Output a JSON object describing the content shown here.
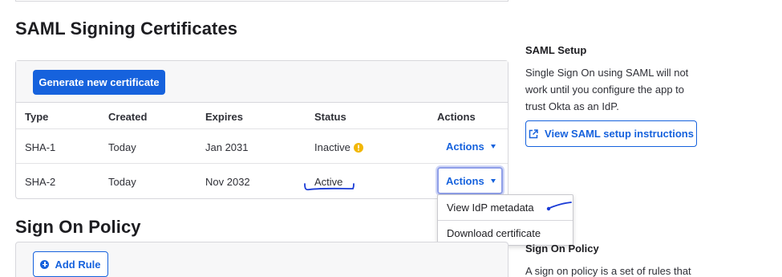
{
  "cert_section": {
    "title": "SAML Signing Certificates",
    "generate_button": "Generate new certificate",
    "columns": [
      "Type",
      "Created",
      "Expires",
      "Status",
      "Actions"
    ],
    "rows": [
      {
        "type": "SHA-1",
        "created": "Today",
        "expires": "Jan 2031",
        "status": "Inactive",
        "status_icon": "warning-icon",
        "actions": "Actions"
      },
      {
        "type": "SHA-2",
        "created": "Today",
        "expires": "Nov 2032",
        "status": "Active",
        "actions": "Actions"
      }
    ]
  },
  "actions_menu": {
    "items": [
      "View IdP metadata",
      "Download certificate"
    ]
  },
  "signon_section": {
    "title": "Sign On Policy",
    "add_rule_button": "Add Rule"
  },
  "sidebar": {
    "saml_setup_title": "SAML Setup",
    "saml_setup_text": "Single Sign On using SAML will not work until you configure the app to trust Okta as an IdP.",
    "view_instructions_button": "View SAML setup instructions",
    "signon_title": "Sign On Policy",
    "signon_text": "A sign on policy is a set of rules that"
  },
  "colors": {
    "primary": "#1662dd",
    "warning": "#f2b705",
    "annotation_ink": "#1a3bd6"
  }
}
